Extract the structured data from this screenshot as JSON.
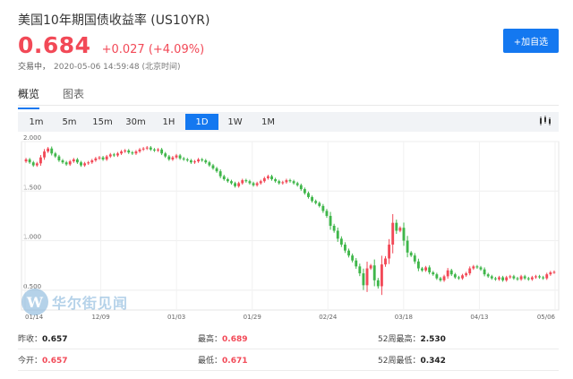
{
  "header": {
    "title": "美国10年期国债收益率  (US10YR)",
    "price": "0.684",
    "change": "+0.027 (+4.09%)",
    "status": "交易中，",
    "timestamp": "2020-05-06 14:59:48",
    "timezone": "(北京时间)",
    "watch_button": "+加自选"
  },
  "tabs": [
    {
      "label": "概览",
      "active": true
    },
    {
      "label": "图表",
      "active": false
    }
  ],
  "ranges": [
    {
      "label": "1m",
      "active": false
    },
    {
      "label": "5m",
      "active": false
    },
    {
      "label": "15m",
      "active": false
    },
    {
      "label": "30m",
      "active": false
    },
    {
      "label": "1H",
      "active": false
    },
    {
      "label": "1D",
      "active": true
    },
    {
      "label": "1W",
      "active": false
    },
    {
      "label": "1M",
      "active": false
    }
  ],
  "settings_icon": "candlestick-settings-icon",
  "watermark": {
    "logo": "W",
    "text": "华尔街见闻"
  },
  "colors": {
    "up": "#f24957",
    "down": "#3fb64a",
    "accent": "#1478f0"
  },
  "chart_data": {
    "type": "candlestick",
    "y_ticks": [
      "2.000",
      "1.500",
      "1.000",
      "0.500"
    ],
    "x_ticks": [
      "01/14",
      "12/09",
      "01/03",
      "01/29",
      "02/24",
      "03/18",
      "04/13",
      "05/06"
    ],
    "ylim": [
      0.3,
      2.0
    ],
    "series": [
      {
        "values": [
          1.82,
          1.79,
          1.76,
          1.78,
          1.84,
          1.9,
          1.93,
          1.88,
          1.85,
          1.81,
          1.79,
          1.77,
          1.8,
          1.82,
          1.79,
          1.76,
          1.78,
          1.79,
          1.81,
          1.83,
          1.84,
          1.82,
          1.85,
          1.87,
          1.86,
          1.88,
          1.9,
          1.91,
          1.89,
          1.88,
          1.9,
          1.92,
          1.93,
          1.94,
          1.92,
          1.91,
          1.92,
          1.88,
          1.85,
          1.82,
          1.84,
          1.86,
          1.83,
          1.82,
          1.81,
          1.79,
          1.8,
          1.82,
          1.81,
          1.79,
          1.76,
          1.73,
          1.7,
          1.65,
          1.62,
          1.6,
          1.58,
          1.55,
          1.58,
          1.61,
          1.6,
          1.58,
          1.56,
          1.58,
          1.6,
          1.63,
          1.65,
          1.62,
          1.6,
          1.58,
          1.59,
          1.61,
          1.6,
          1.58,
          1.56,
          1.52,
          1.48,
          1.44,
          1.4,
          1.38,
          1.35,
          1.3,
          1.25,
          1.15,
          1.1,
          1.02,
          0.96,
          0.9,
          0.85,
          0.8,
          0.74,
          0.67,
          0.55,
          0.72,
          0.75,
          0.6,
          0.54,
          0.76,
          0.82,
          0.96,
          1.18,
          1.1,
          1.13,
          1.0,
          0.88,
          0.85,
          0.79,
          0.72,
          0.7,
          0.73,
          0.68,
          0.66,
          0.62,
          0.6,
          0.64,
          0.7,
          0.66,
          0.63,
          0.62,
          0.65,
          0.67,
          0.72,
          0.74,
          0.73,
          0.71,
          0.66,
          0.64,
          0.62,
          0.61,
          0.63,
          0.6,
          0.63,
          0.64,
          0.62,
          0.61,
          0.64,
          0.62,
          0.61,
          0.63,
          0.64,
          0.63,
          0.62,
          0.66,
          0.68,
          0.684
        ]
      }
    ]
  },
  "stats": [
    [
      {
        "label": "昨收：",
        "value": "0.657",
        "red": false
      },
      {
        "label": "最高：",
        "value": "0.689",
        "red": true
      },
      {
        "label": "52周最高：",
        "value": "2.530",
        "red": false
      }
    ],
    [
      {
        "label": "今开：",
        "value": "0.657",
        "red": true
      },
      {
        "label": "最低：",
        "value": "0.671",
        "red": true
      },
      {
        "label": "52周最低：",
        "value": "0.342",
        "red": false
      }
    ]
  ]
}
